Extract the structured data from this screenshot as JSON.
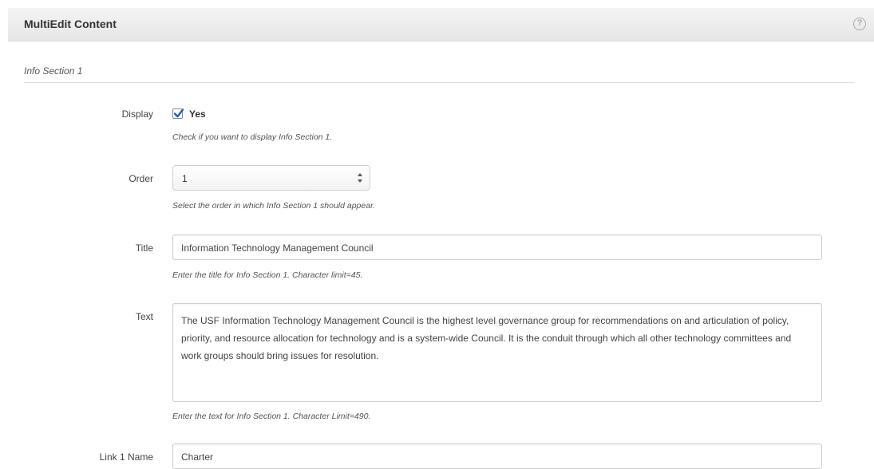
{
  "panel": {
    "title": "MultiEdit Content",
    "help_icon": "help-icon"
  },
  "section": {
    "title": "Info Section 1"
  },
  "fields": {
    "display": {
      "label": "Display",
      "checkbox_label": "Yes",
      "checked": true,
      "help": "Check if you want to display Info Section 1."
    },
    "order": {
      "label": "Order",
      "value": "1",
      "help": "Select the order in which Info Section 1 should appear."
    },
    "title": {
      "label": "Title",
      "value": "Information Technology Management Council",
      "help": "Enter the title for Info Section 1. Character limit=45."
    },
    "text": {
      "label": "Text",
      "value": "The USF Information Technology Management Council is the highest level governance group for recommendations on and articulation of policy, priority, and resource allocation for technology and is a system-wide Council. It is the conduit through which all other technology committees and work groups should bring issues for resolution.",
      "help": "Enter the text for Info Section 1. Character Limit=490."
    },
    "link1_name": {
      "label": "Link 1 Name",
      "value": "Charter"
    }
  }
}
